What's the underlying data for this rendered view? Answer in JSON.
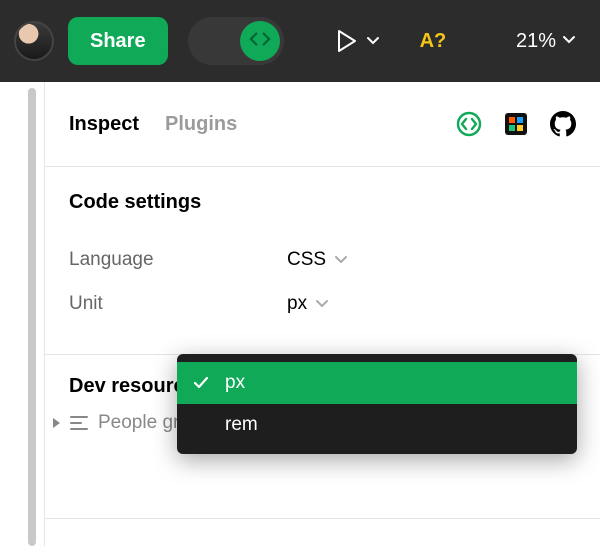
{
  "toolbar": {
    "share_label": "Share",
    "autolayout_label": "A?",
    "zoom_label": "21%"
  },
  "tabs": {
    "inspect": "Inspect",
    "plugins": "Plugins"
  },
  "code_settings": {
    "title": "Code settings",
    "language_label": "Language",
    "language_value": "CSS",
    "unit_label": "Unit",
    "unit_value": "px"
  },
  "dev_resources": {
    "title": "Dev resources",
    "layer_name": "People gri"
  },
  "unit_menu": {
    "options": [
      "px",
      "rem"
    ],
    "selected": "px"
  }
}
